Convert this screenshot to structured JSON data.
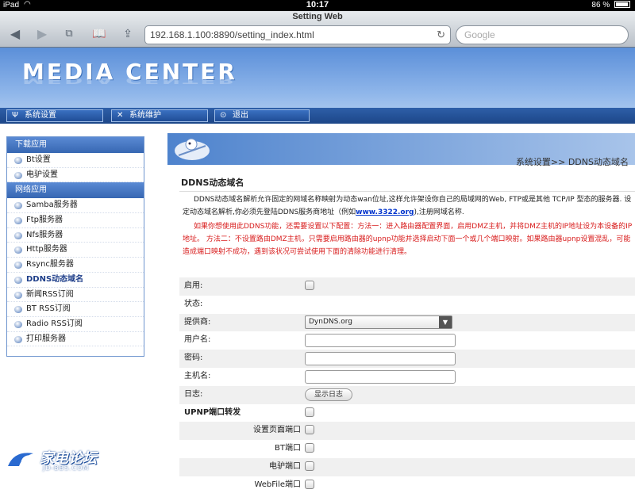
{
  "status_bar": {
    "device": "iPad",
    "time": "10:17",
    "battery": "86 %"
  },
  "browser": {
    "page_title": "Setting Web",
    "url": "192.168.1.100:8890/setting_index.html",
    "search_placeholder": "Google"
  },
  "header": {
    "logo": "MEDIA CENTER",
    "menu": [
      {
        "label": "系统设置",
        "icon": "wrench-icon"
      },
      {
        "label": "系统维护",
        "icon": "tools-icon"
      },
      {
        "label": "退出",
        "icon": "power-icon"
      }
    ]
  },
  "sidebar": {
    "sections": [
      {
        "title": "下载应用",
        "items": [
          "Bt设置",
          "电驴设置"
        ]
      },
      {
        "title": "网络应用",
        "items": [
          "Samba服务器",
          "Ftp服务器",
          "Nfs服务器",
          "Http服务器",
          "Rsync服务器",
          "DDNS动态域名",
          "新闻RSS订阅",
          "BT RSS订阅",
          "Radio RSS订阅",
          "打印服务器"
        ]
      }
    ],
    "active_item": "DDNS动态域名"
  },
  "main": {
    "breadcrumb": "系统设置>> DDNS动态域名",
    "section_title": "DDNS动态域名",
    "description_pre": "DDNS动态域名解析允许固定的网域名称映射为动态wan位址,这样允许架设你自己的局域网的Web, FTP或是其他 TCP/IP 型态的服务器. 设定动态域名解析,你必须先登陆DDNS服务商地址（例如",
    "description_link": "www.3322.org",
    "description_post": "),注册网域名称.",
    "warning": "如果你想使用此DDNS功能，还需要设置以下配置：方法一：进入路由器配置界面，启用DMZ主机，并将DMZ主机的IP地址设为本设备的IP地址。 方法二：不设置路由DMZ主机，只需要启用路由器的upnp功能并选择启动下面一个或几个端口映射。如果路由器upnp设置混乱，可能造成端口映射不成功，遇到该状况可尝试使用下面的清除功能进行清理。",
    "fields": {
      "enable_label": "启用:",
      "status_label": "状态:",
      "provider_label": "提供商:",
      "provider_value": "DynDNS.org",
      "username_label": "用户名:",
      "password_label": "密码:",
      "hostname_label": "主机名:",
      "log_label": "日志:",
      "log_button": "显示日志",
      "upnp_label": "UPNP端口转发",
      "setting_port_label": "设置页面端口",
      "bt_port_label": "BT端口",
      "edonkey_port_label": "电驴端口",
      "webfile_port_label": "WebFile端口"
    }
  },
  "watermark": {
    "title": "家电论坛",
    "sub": "JD-BBS.COM"
  }
}
